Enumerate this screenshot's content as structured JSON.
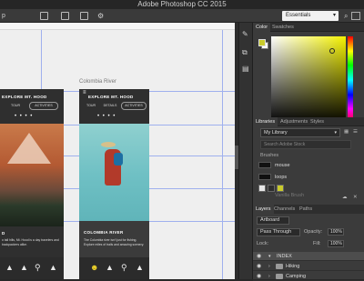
{
  "app": {
    "title": "Adobe Photoshop CC 2015"
  },
  "options_bar": {
    "left_text": "p",
    "workspace": "Essentials"
  },
  "canvas": {
    "artboard_label": "Colombia River",
    "phone1": {
      "title": "EXPLORE MT. HOOD",
      "tabs": [
        "TOUR",
        "ACTIVITIES"
      ],
      "dots": "• • • •",
      "card_title": "D",
      "card_text": "o tall hills, Mt. Hood is a day travelers and backpackers alike.",
      "bottom_icons": [
        "▲",
        "▲",
        "⚲",
        "▲"
      ]
    },
    "phone2": {
      "title": "EXPLORE MT. HOOD",
      "tabs": [
        "TOUR",
        "DETAILS",
        "ACTIVITIES"
      ],
      "dots": "• • • •",
      "card_title": "COLOMBIA RIVER",
      "card_text": "The Columbia river isn't just for fishing. Explore miles of trails and amazing scenery.",
      "bottom_icons": [
        "☻",
        "▲",
        "⚲",
        "▲"
      ]
    }
  },
  "panel": {
    "color_tabs": [
      "Color",
      "Swatches"
    ],
    "library_tabs": [
      "Libraries",
      "Adjustments",
      "Styles"
    ],
    "library_select": "My Library",
    "search_placeholder": "Search Adobe Stock",
    "brushes_heading": "Brushes",
    "brushes": [
      "mouse",
      "loops",
      "Vanilla Brush"
    ],
    "layers_tabs": [
      "Layers",
      "Channels",
      "Paths"
    ],
    "kind": "Artboard",
    "blend": "Pass Through",
    "opacity_label": "Opacity:",
    "opacity_value": "100%",
    "lock_label": "Lock:",
    "fill_label": "Fill:",
    "fill_value": "100%",
    "layers": [
      "INDEX",
      "Hiking",
      "Camping"
    ]
  }
}
